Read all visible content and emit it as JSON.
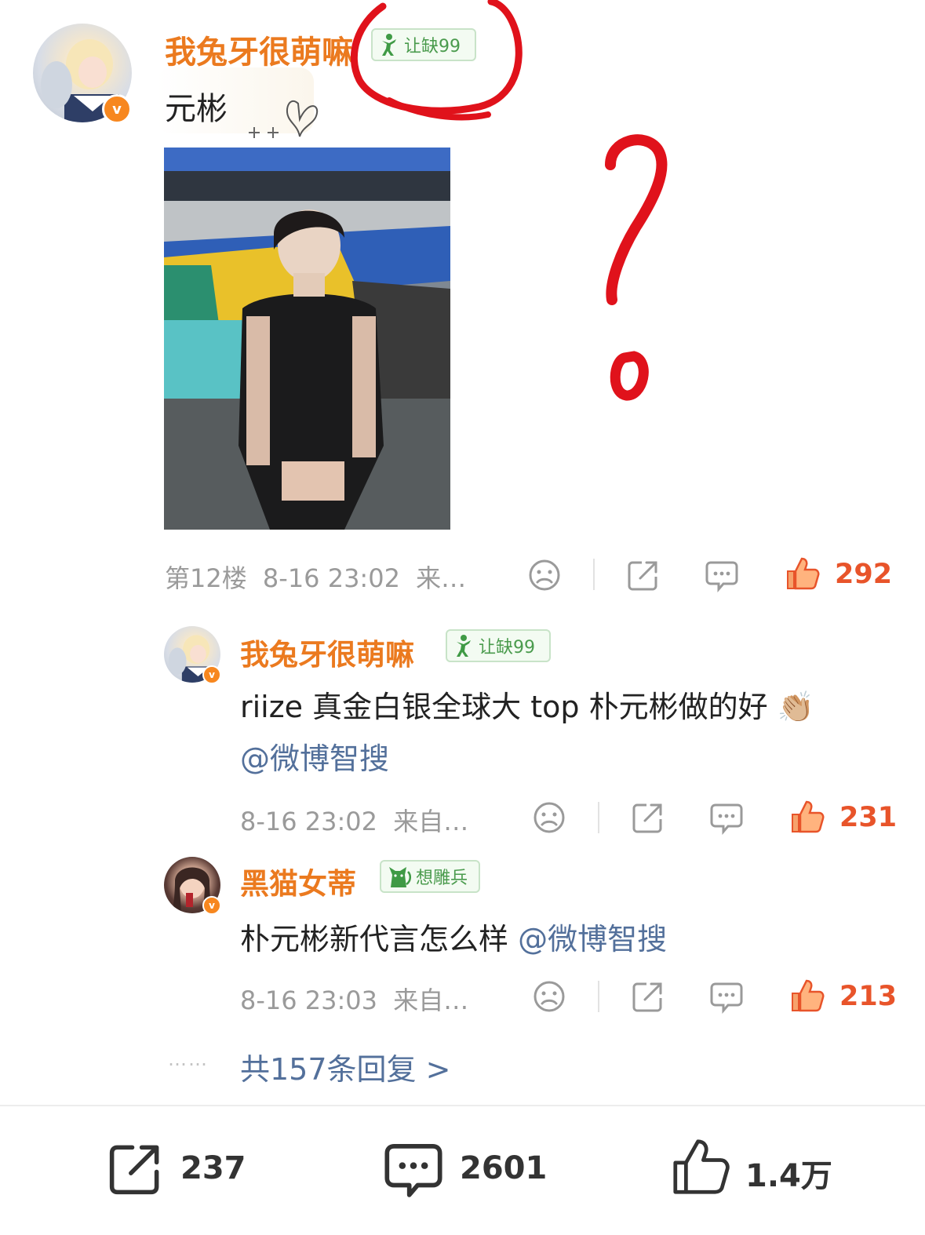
{
  "main_comment": {
    "username": "我兔牙很萌嘛",
    "badge_label": "让缺99",
    "text": "元彬",
    "floor": "第12楼",
    "time": "8-16 23:02",
    "source": "来…",
    "like_count": "292"
  },
  "replies": [
    {
      "username": "我兔牙很萌嘛",
      "badge_label": "让缺99",
      "text": "riize 真金白银全球大 top 朴元彬做的好",
      "emoji": "👏🏼",
      "mention": "@微博智搜",
      "time": "8-16 23:02",
      "source": "来自…",
      "like_count": "231"
    },
    {
      "username": "黑猫女蒂",
      "badge_label": "想雕兵",
      "text": "朴元彬新代言怎么样",
      "mention": "@微博智搜",
      "time": "8-16 23:03",
      "source": "来自…",
      "like_count": "213"
    }
  ],
  "more_replies": {
    "dots": "……",
    "label": "共157条回复 >"
  },
  "bottom_bar": {
    "share_count": "237",
    "comment_count": "2601",
    "like_count": "1.4万"
  },
  "annotations": {
    "question_mark_color": "#e0121b",
    "circle_color": "#e0121b"
  },
  "icons": {
    "dislike": "sad-face-icon",
    "share": "share-icon",
    "comment": "comment-icon",
    "like": "thumbs-up-icon",
    "verified": "verified-v-icon",
    "badge": "fan-badge-icon"
  },
  "colors": {
    "username": "#eb7a1f",
    "like": "#e8542a",
    "mention": "#53709b",
    "meta": "#9a9a9a",
    "badge_green": "#4a9b4d"
  }
}
